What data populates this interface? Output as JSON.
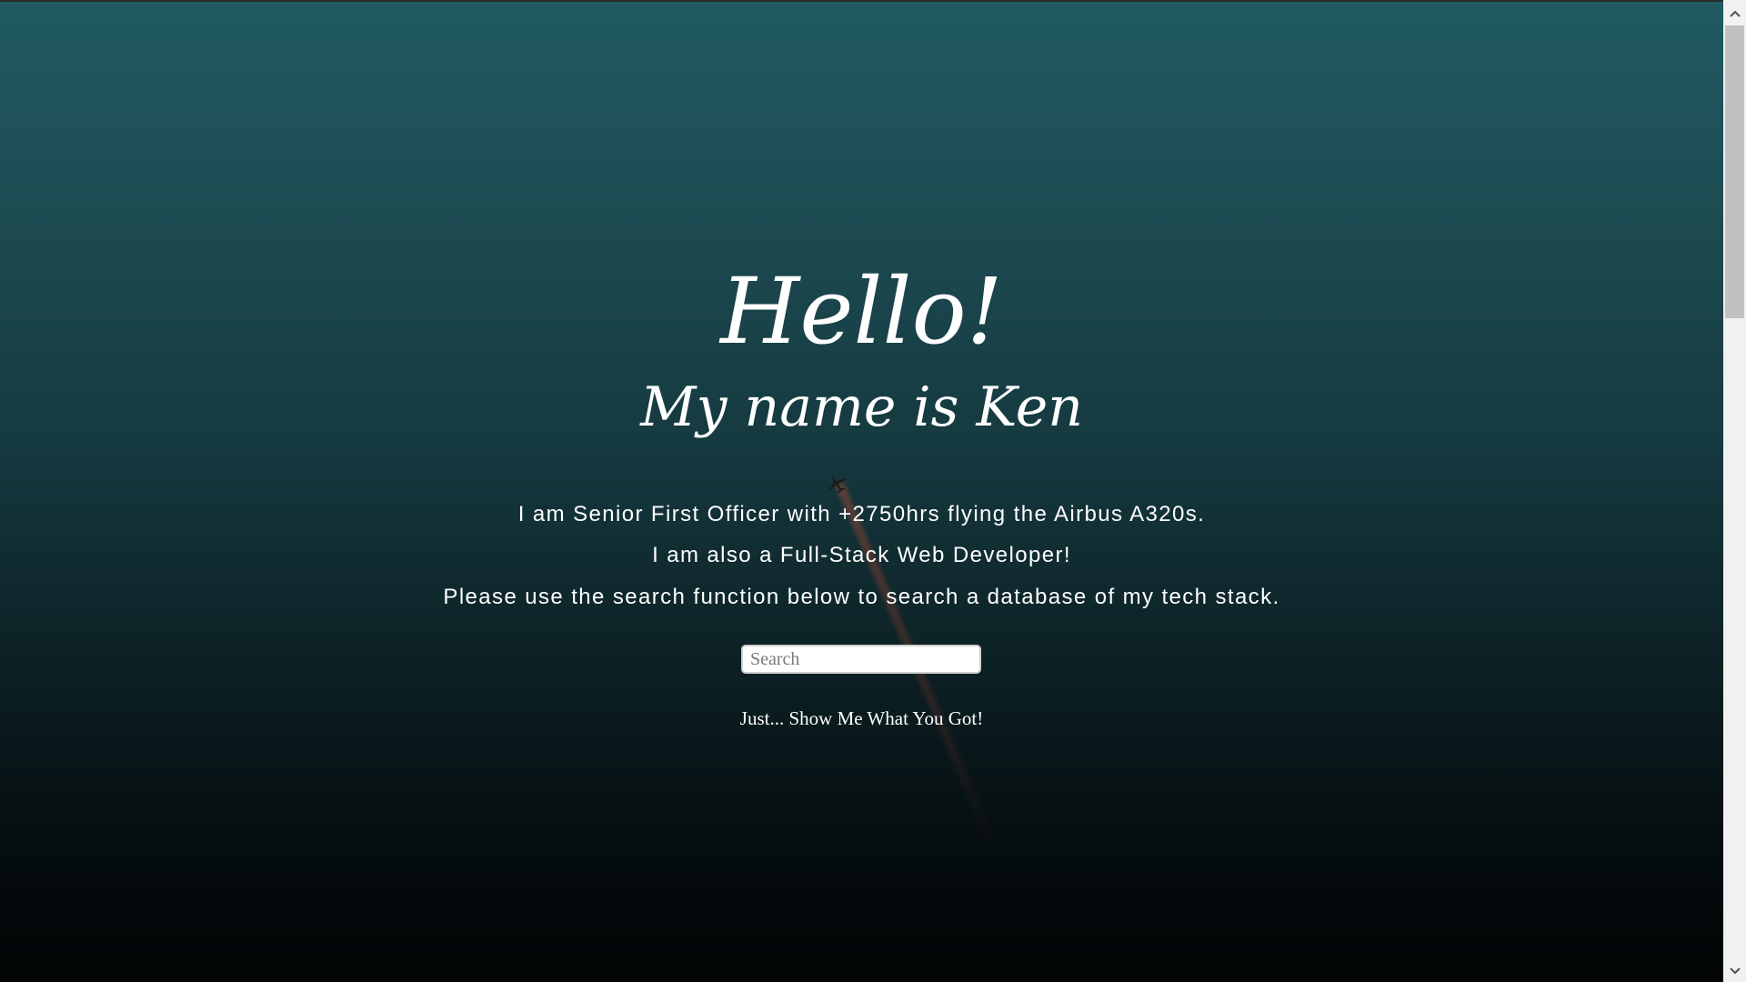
{
  "page": {
    "background_top": "#215a62",
    "background_bottom": "#020405"
  },
  "hero": {
    "greeting": "Hello!",
    "name_line": "My name is Ken",
    "paragraphs": [
      "I am Senior First Officer with +2750hrs flying the Airbus A320s.",
      "I am also a Full-Stack Web Developer!",
      "Please use the search function below to search a database of my tech stack."
    ]
  },
  "search": {
    "placeholder": "Search",
    "value": ""
  },
  "show_all_link": "Just... Show Me What You Got!",
  "icons": {
    "plane": "airplane-icon",
    "scroll_up": "chevron-up-icon",
    "scroll_down": "chevron-down-icon"
  }
}
